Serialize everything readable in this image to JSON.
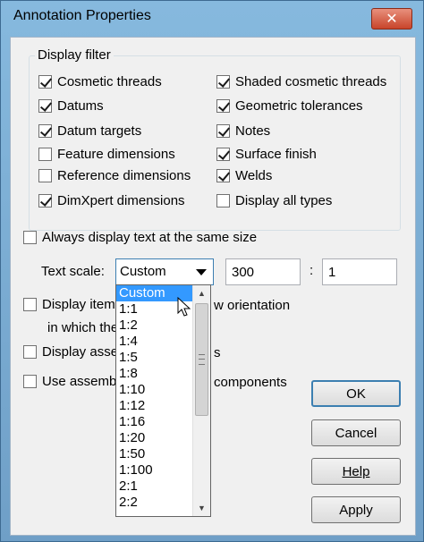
{
  "window": {
    "title": "Annotation Properties",
    "close_label": "✕"
  },
  "display_filter": {
    "label": "Display filter",
    "left": [
      {
        "label": "Cosmetic threads",
        "checked": true
      },
      {
        "label": "Datums",
        "checked": true
      },
      {
        "label": "Datum targets",
        "checked": true
      },
      {
        "label": "Feature dimensions",
        "checked": false
      },
      {
        "label": "Reference dimensions",
        "checked": false
      },
      {
        "label": "DimXpert dimensions",
        "checked": true
      }
    ],
    "right": [
      {
        "label": "Shaded cosmetic threads",
        "checked": true
      },
      {
        "label": "Geometric tolerances",
        "checked": true
      },
      {
        "label": "Notes",
        "checked": true
      },
      {
        "label": "Surface finish",
        "checked": true
      },
      {
        "label": "Welds",
        "checked": true
      },
      {
        "label": "Display all types",
        "checked": false
      }
    ]
  },
  "options": {
    "same_size": {
      "label": "Always display text at the same size",
      "checked": false
    },
    "view_orientation": {
      "label_line1": "Display item",
      "label_line1_tail": "w orientation",
      "label_line2": "in which the",
      "checked": false
    },
    "assembly_scale": {
      "label": "Display asse",
      "label_tail": "s",
      "checked": false
    },
    "assembly_components": {
      "label": "Use assemb",
      "label_tail": "components",
      "checked": false
    }
  },
  "text_scale": {
    "label": "Text scale:",
    "selected": "Custom",
    "numerator": "300",
    "separator": ":",
    "denominator": "1",
    "options": [
      "Custom",
      "1:1",
      "1:2",
      "1:4",
      "1:5",
      "1:8",
      "1:10",
      "1:12",
      "1:16",
      "1:20",
      "1:50",
      "1:100",
      "2:1",
      "2:2"
    ]
  },
  "buttons": {
    "ok": "OK",
    "cancel": "Cancel",
    "help": "Help",
    "apply": "Apply"
  },
  "icons": {
    "close": "close-icon",
    "dropdown": "chevron-down-icon",
    "cursor": "mouse-pointer-icon"
  }
}
